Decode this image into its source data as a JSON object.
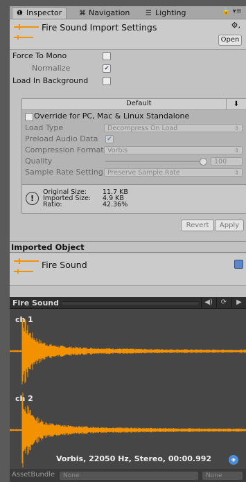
{
  "tabs": [
    {
      "label": "Inspector",
      "icon": "info-icon"
    },
    {
      "label": "Navigation",
      "icon": "navigation-icon"
    },
    {
      "label": "Lighting",
      "icon": "lighting-icon"
    }
  ],
  "header": {
    "title": "Fire Sound Import Settings",
    "open_label": "Open"
  },
  "settings": {
    "force_to_mono": {
      "label": "Force To Mono",
      "checked": false
    },
    "normalize": {
      "label": "Normalize",
      "checked": true
    },
    "load_in_background": {
      "label": "Load In Background",
      "checked": false
    }
  },
  "platform": {
    "tab_label": "Default",
    "override_label": "Override for PC, Mac & Linux Standalone",
    "load_type_label": "Load Type",
    "load_type_value": "Decompress On Load",
    "preload_label": "Preload Audio Data",
    "compression_label": "Compression Format",
    "compression_value": "Vorbis",
    "quality_label": "Quality",
    "quality_value": "100",
    "sample_rate_label": "Sample Rate Setting",
    "sample_rate_value": "Preserve Sample Rate"
  },
  "stats": {
    "original_label": "Original Size:",
    "original_value": "11.7 KB",
    "imported_label": "Imported Size:",
    "imported_value": "4.9 KB",
    "ratio_label": "Ratio:",
    "ratio_value": "42.36%"
  },
  "actions": {
    "revert": "Revert",
    "apply": "Apply"
  },
  "imported_object": {
    "section_title": "Imported Object",
    "name": "Fire Sound"
  },
  "preview": {
    "title": "Fire Sound",
    "channels": [
      "ch 1",
      "ch 2"
    ],
    "format": "Vorbis, 22050 Hz, Stereo, 00:00.992"
  },
  "asset_bundle": {
    "label": "AssetBundle",
    "name_value": "None",
    "variant_value": "None"
  },
  "colors": {
    "waveform": "#f39200",
    "panel": "#c2c2c2",
    "preview_bg": "#464646"
  }
}
